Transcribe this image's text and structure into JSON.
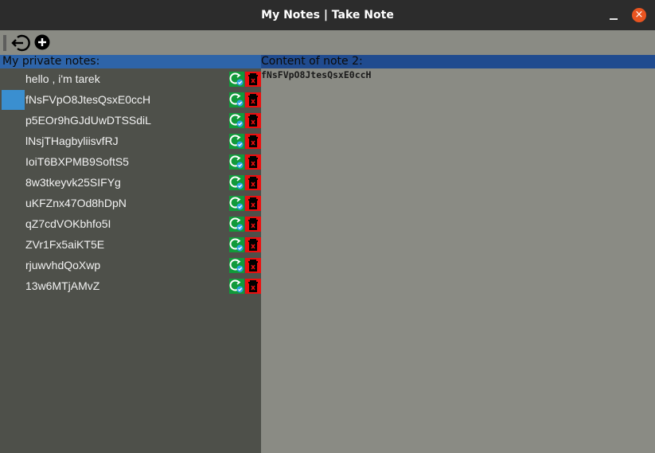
{
  "window": {
    "title": "My Notes | Take Note",
    "close_label": "×"
  },
  "toolbar": {
    "back_icon": "logout-arrow-icon",
    "add_icon": "plus-circle-icon"
  },
  "notes_panel": {
    "header": "My private notes:",
    "notes": [
      {
        "title": "hello , i'm tarek",
        "selected": false
      },
      {
        "title": "fNsFVpO8JtesQsxE0ccH",
        "selected": true
      },
      {
        "title": "p5EOr9hGJdUwDTSSdiL",
        "selected": false
      },
      {
        "title": "lNsjTHagbyliisvfRJ",
        "selected": false
      },
      {
        "title": "IoiT6BXPMB9SoftS5",
        "selected": false
      },
      {
        "title": "8w3tkeyvk25SIFYg",
        "selected": false
      },
      {
        "title": "uKFZnx47Od8hDpN",
        "selected": false
      },
      {
        "title": "qZ7cdVOKbhfo5I",
        "selected": false
      },
      {
        "title": "ZVr1Fx5aiKT5E",
        "selected": false
      },
      {
        "title": "rjuwvhdQoXwp",
        "selected": false
      },
      {
        "title": "13w6MTjAMvZ",
        "selected": false
      }
    ]
  },
  "content_panel": {
    "header": "Content of note 2:",
    "body": "fNsFVpO8JtesQsxE0ccH"
  },
  "colors": {
    "open_button": "#119a3a",
    "delete_button": "#ea1010",
    "header_bar": "#2e64a8",
    "selection": "#3a8fd0"
  }
}
